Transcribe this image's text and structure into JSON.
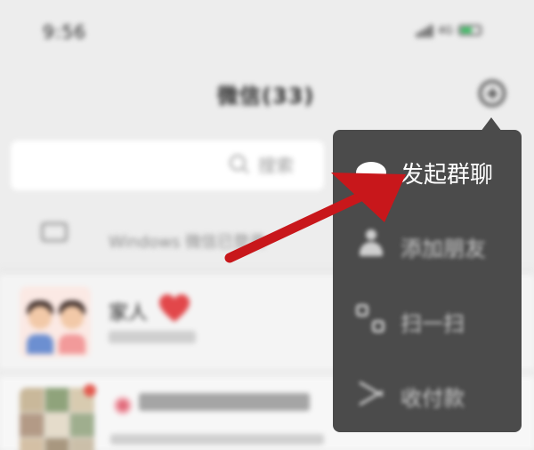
{
  "status_bar": {
    "time": "9:56",
    "network": "4G"
  },
  "header": {
    "title": "微信(33)",
    "add_icon": "plus-circle-icon"
  },
  "search": {
    "placeholder": "搜索"
  },
  "windows_banner": {
    "text": "Windows 微信已登录"
  },
  "chats": [
    {
      "name": "家人"
    }
  ],
  "popup_menu": {
    "items": [
      {
        "label": "发起群聊",
        "icon": "chat-bubble-icon"
      },
      {
        "label": "添加朋友",
        "icon": "add-friend-icon"
      },
      {
        "label": "扫一扫",
        "icon": "scan-icon"
      },
      {
        "label": "收付款",
        "icon": "pay-icon"
      }
    ]
  },
  "colors": {
    "menu_bg": "#4b4b4b",
    "annotation_red": "#c8171b",
    "app_bg": "#ededed"
  }
}
